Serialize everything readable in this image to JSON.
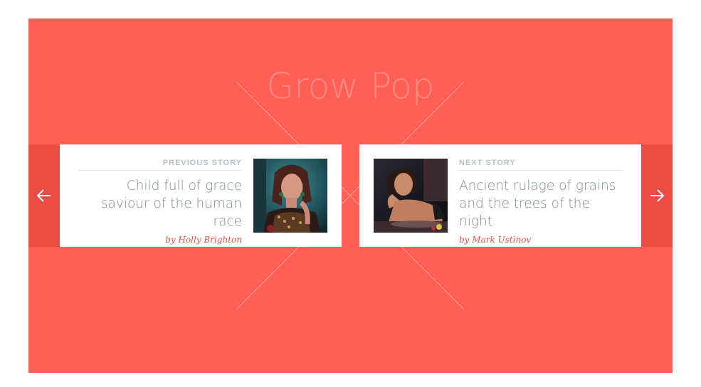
{
  "page": {
    "title": "Grow Pop",
    "background_color": "#ff5f55",
    "accent_color": "#ea4c43"
  },
  "previous_story": {
    "kicker": "PREVIOUS STORY",
    "headline": "Child full of grace saviour of the human race",
    "author": "by Holly Brighton"
  },
  "next_story": {
    "kicker": "NEXT STORY",
    "headline": "Ancient rulage of grains and the trees of the night",
    "author": "by Mark Ustinov"
  },
  "icons": {
    "prev": "arrow-left-icon",
    "next": "arrow-right-icon"
  }
}
